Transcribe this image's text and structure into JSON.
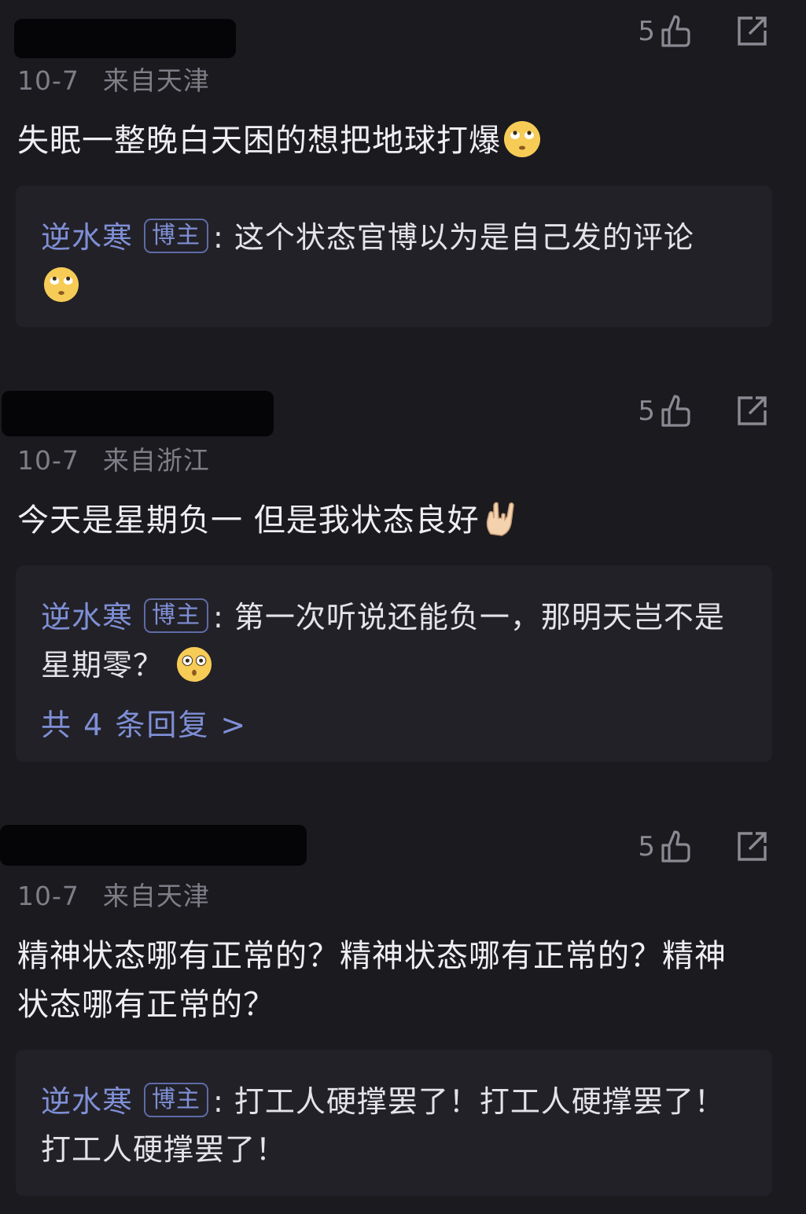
{
  "comments": [
    {
      "likes": "5",
      "date": "10-7",
      "location": "来自天津",
      "text": "失眠一整晚白天困的想把地球打爆",
      "emoji": "rolling-eyes-emoji",
      "reply": {
        "author": "逆水寒",
        "tag": "博主",
        "separator": ":",
        "text": "这个状态官博以为是自己发的评论",
        "emoji": "rolling-eyes-emoji"
      }
    },
    {
      "likes": "5",
      "date": "10-7",
      "location": "来自浙江",
      "text": "今天是星期负一 但是我状态良好",
      "emoji": "rock-on-hand-emoji",
      "reply": {
        "author": "逆水寒",
        "tag": "博主",
        "separator": ":",
        "text": "第一次听说还能负一，那明天岂不是星期零？",
        "emoji": "hushed-face-emoji",
        "more": "共 4 条回复 >"
      }
    },
    {
      "likes": "5",
      "date": "10-7",
      "location": "来自天津",
      "text": "精神状态哪有正常的？精神状态哪有正常的？精神状态哪有正常的？",
      "reply": {
        "author": "逆水寒",
        "tag": "博主",
        "separator": ":",
        "text": "打工人硬撑罢了！打工人硬撑罢了！打工人硬撑罢了！"
      }
    }
  ],
  "icons": {
    "like": "thumbs-up-outline-icon",
    "share": "share-external-icon"
  },
  "colors": {
    "background": "#1b1a1f",
    "reply_background": "#222127",
    "accent": "#7f8fd6",
    "meta": "#7f7d86",
    "redaction": "#050507"
  }
}
